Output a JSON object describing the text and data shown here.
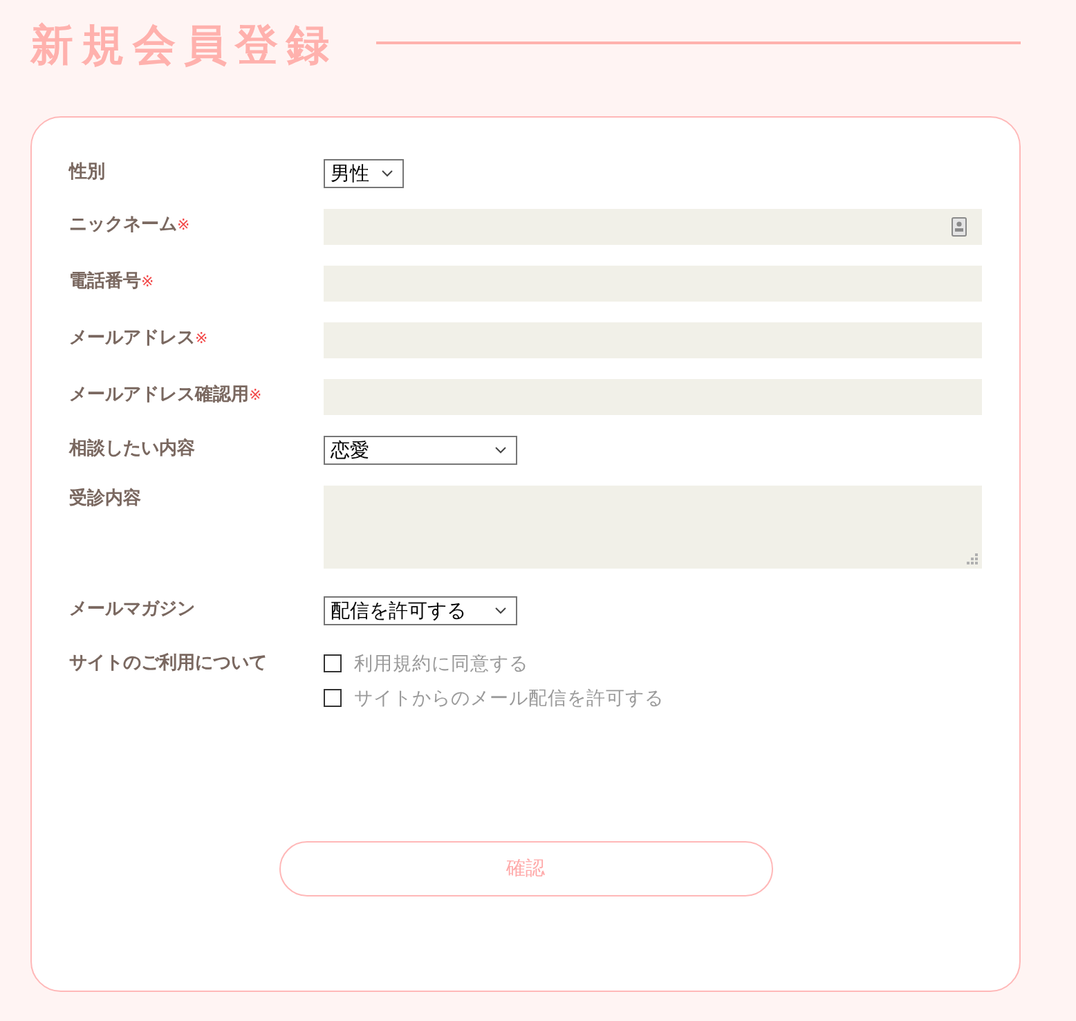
{
  "header": {
    "title": "新規会員登録"
  },
  "form": {
    "fields": [
      {
        "kind": "select",
        "label": "性別",
        "value": "男性"
      },
      {
        "kind": "text",
        "label": "ニックネーム",
        "required_mark": "※",
        "autofill": true
      },
      {
        "kind": "text",
        "label": "電話番号",
        "required_mark": "※",
        "autofill": false
      },
      {
        "kind": "text",
        "label": "メールアドレス",
        "required_mark": "※",
        "autofill": false
      },
      {
        "kind": "text",
        "label": "メールアドレス確認用",
        "required_mark": "※",
        "autofill": false
      },
      {
        "kind": "select",
        "label": "相談したい内容",
        "value": "恋愛"
      },
      {
        "kind": "textarea",
        "label": "受診内容"
      },
      {
        "kind": "select",
        "label": "メールマガジン",
        "value": "配信を許可する"
      },
      {
        "kind": "checkboxes",
        "label": "サイトのご利用について",
        "options": [
          {
            "label": "利用規約に同意する",
            "checked": false
          },
          {
            "label": "サイトからのメール配信を許可する",
            "checked": false
          }
        ]
      }
    ],
    "submit": {
      "label": "確認"
    }
  }
}
